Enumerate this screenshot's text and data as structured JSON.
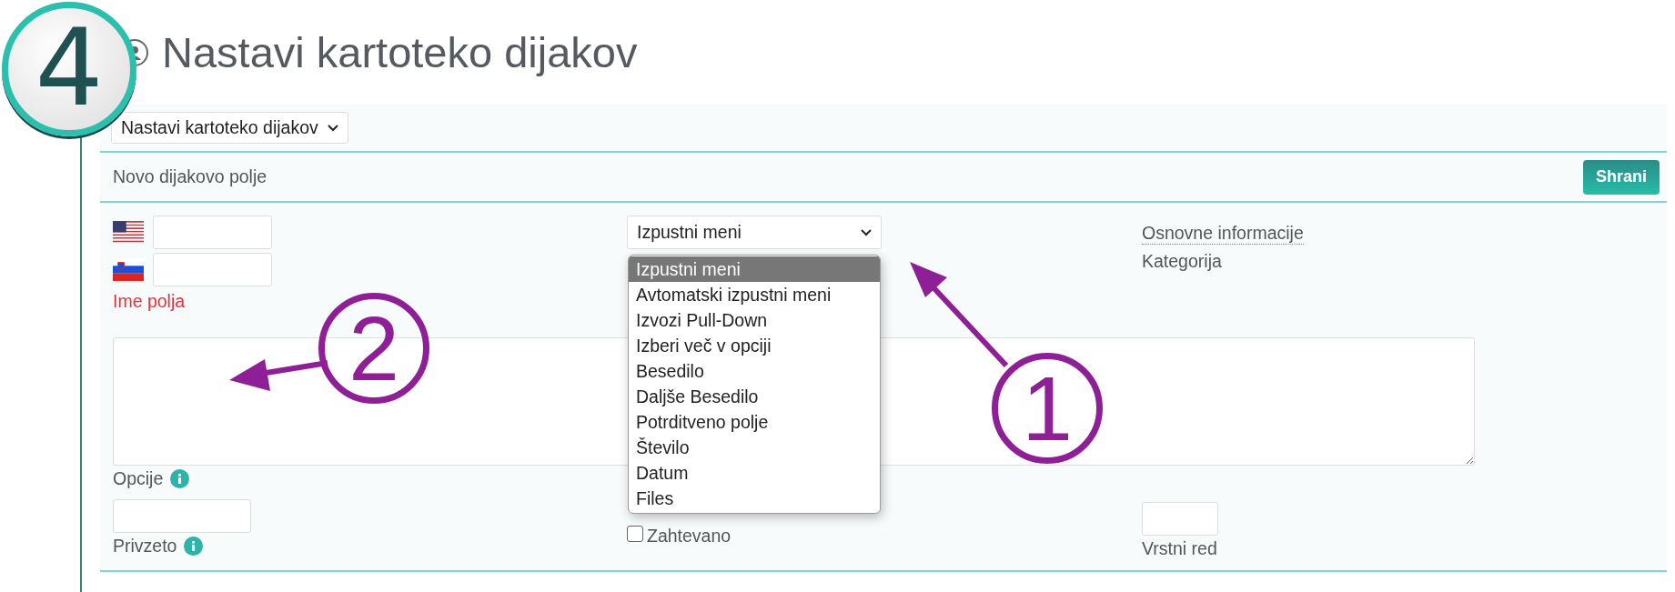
{
  "badge": {
    "text": "4"
  },
  "page": {
    "title": "Nastavi kartoteko dijakov"
  },
  "view_select": {
    "value": "Nastavi kartoteko dijakov"
  },
  "form_header": {
    "title": "Novo dijakovo polje",
    "save_button": "Shrani"
  },
  "field_name": {
    "inputs": [
      {
        "kind": "us"
      },
      {
        "kind": "si"
      }
    ],
    "label": "Ime polja",
    "invalid": true
  },
  "type_select": {
    "value": "Izpustni meni",
    "expanded": true,
    "options": [
      {
        "label": "Izpustni meni",
        "selected": true
      },
      {
        "label": "Avtomatski izpustni meni",
        "selected": false
      },
      {
        "label": "Izvozi Pull-Down",
        "selected": false
      },
      {
        "label": "Izberi več v opciji",
        "selected": false
      },
      {
        "label": "Besedilo",
        "selected": false
      },
      {
        "label": "Daljše Besedilo",
        "selected": false
      },
      {
        "label": "Potrditveno polje",
        "selected": false
      },
      {
        "label": "Število",
        "selected": false
      },
      {
        "label": "Datum",
        "selected": false
      },
      {
        "label": "Files",
        "selected": false
      }
    ]
  },
  "category": {
    "value": "Osnovne informacije",
    "label": "Kategorija"
  },
  "options_field": {
    "label": "Opcije",
    "info": true
  },
  "default_field": {
    "label": "Privzeto",
    "info": true
  },
  "required": {
    "label": "Zahtevano",
    "checked": false
  },
  "order_field": {
    "label": "Vrstni red"
  },
  "annotations": [
    {
      "text": "1"
    },
    {
      "text": "2"
    }
  ]
}
